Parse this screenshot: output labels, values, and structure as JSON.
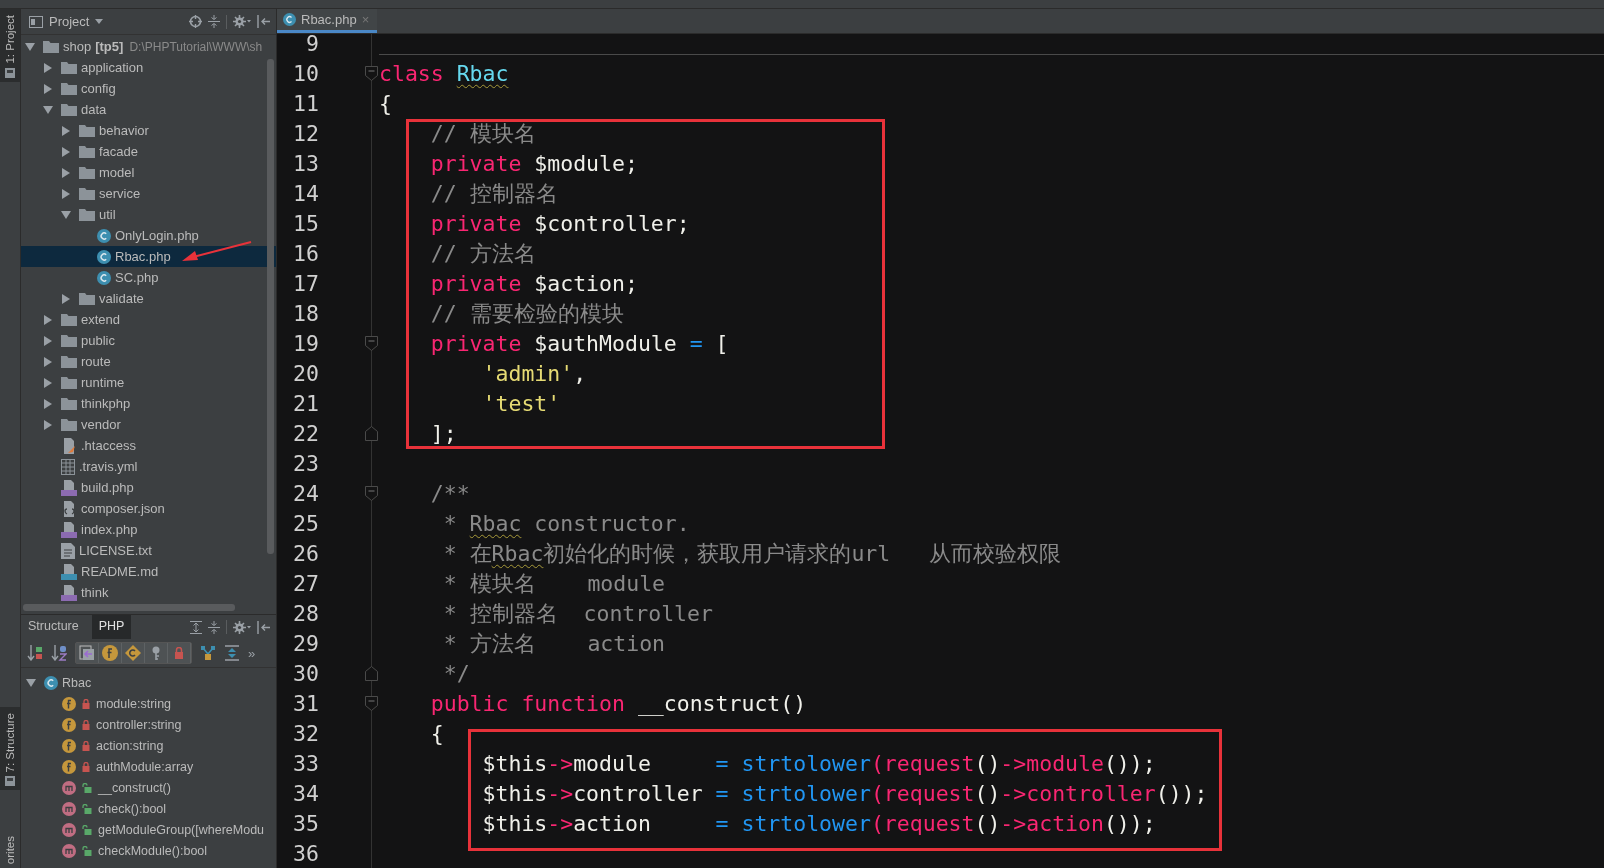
{
  "tool_strip": {
    "items": [
      {
        "label": "1: Project",
        "selected": true
      },
      {
        "label": "7: Structure",
        "selected": true
      },
      {
        "label": "orites",
        "selected": false
      }
    ]
  },
  "project": {
    "title": "Project",
    "tree": [
      {
        "name": "shop",
        "tag": "[tp5]",
        "path": "D:\\PHPTutorial\\WWW\\sh",
        "kind": "folder",
        "expanded": true,
        "selected": false,
        "children": [
          {
            "name": "application",
            "kind": "folder",
            "expanded": false,
            "selected": false
          },
          {
            "name": "config",
            "kind": "folder",
            "expanded": false,
            "selected": false
          },
          {
            "name": "data",
            "kind": "folder",
            "expanded": true,
            "selected": false,
            "children": [
              {
                "name": "behavior",
                "kind": "folder",
                "expanded": false,
                "selected": false
              },
              {
                "name": "facade",
                "kind": "folder",
                "expanded": false,
                "selected": false
              },
              {
                "name": "model",
                "kind": "folder",
                "expanded": false,
                "selected": false
              },
              {
                "name": "service",
                "kind": "folder",
                "expanded": false,
                "selected": false
              },
              {
                "name": "util",
                "kind": "folder",
                "expanded": true,
                "selected": false,
                "children": [
                  {
                    "name": "OnlyLogin.php",
                    "kind": "class",
                    "selected": false
                  },
                  {
                    "name": "Rbac.php",
                    "kind": "class",
                    "selected": true
                  },
                  {
                    "name": "SC.php",
                    "kind": "class",
                    "selected": false
                  }
                ]
              },
              {
                "name": "validate",
                "kind": "folder",
                "expanded": false,
                "selected": false
              }
            ]
          },
          {
            "name": "extend",
            "kind": "folder",
            "expanded": false,
            "selected": false
          },
          {
            "name": "public",
            "kind": "folder",
            "expanded": false,
            "selected": false
          },
          {
            "name": "route",
            "kind": "folder",
            "expanded": false,
            "selected": false
          },
          {
            "name": "runtime",
            "kind": "folder",
            "expanded": false,
            "selected": false
          },
          {
            "name": "thinkphp",
            "kind": "folder",
            "expanded": false,
            "selected": false
          },
          {
            "name": "vendor",
            "kind": "folder",
            "expanded": false,
            "selected": false
          },
          {
            "name": ".htaccess",
            "kind": "htaccess",
            "selected": false
          },
          {
            "name": ".travis.yml",
            "kind": "yml",
            "selected": false
          },
          {
            "name": "build.php",
            "kind": "php",
            "selected": false
          },
          {
            "name": "composer.json",
            "kind": "json",
            "selected": false
          },
          {
            "name": "index.php",
            "kind": "php",
            "selected": false
          },
          {
            "name": "LICENSE.txt",
            "kind": "txt",
            "selected": false
          },
          {
            "name": "README.md",
            "kind": "md",
            "selected": false
          },
          {
            "name": "think",
            "kind": "php",
            "selected": false
          }
        ]
      }
    ]
  },
  "structure": {
    "tabs": [
      {
        "label": "Structure",
        "selected": false
      },
      {
        "label": "PHP",
        "selected": true
      }
    ],
    "more": "»",
    "tree": [
      {
        "name": "Rbac",
        "kind": "class",
        "expanded": true,
        "selected": false,
        "children": [
          {
            "name": "module:string",
            "kind": "field",
            "locked": true,
            "selected": false
          },
          {
            "name": "controller:string",
            "kind": "field",
            "locked": true,
            "selected": false
          },
          {
            "name": "action:string",
            "kind": "field",
            "locked": true,
            "selected": false
          },
          {
            "name": "authModule:array",
            "kind": "field",
            "locked": true,
            "selected": false
          },
          {
            "name": "__construct()",
            "kind": "method",
            "locked": false,
            "selected": false
          },
          {
            "name": "check():bool",
            "kind": "method",
            "locked": false,
            "selected": false
          },
          {
            "name": "getModuleGroup([whereModu",
            "kind": "method",
            "locked": false,
            "selected": false
          },
          {
            "name": "checkModule():bool",
            "kind": "method",
            "locked": false,
            "selected": false
          }
        ]
      }
    ]
  },
  "editor": {
    "tabs": [
      {
        "label": "Rbac.php",
        "close": "×",
        "selected": true
      }
    ],
    "lines": [
      {
        "number": "9"
      },
      {
        "number": "10",
        "fold_start": true,
        "separator_above": true,
        "tokens": [
          {
            "kind": "kw",
            "text": "class "
          },
          {
            "kind": "cls",
            "text": "Rbac",
            "squiggle": true
          }
        ]
      },
      {
        "number": "11",
        "tokens": [
          {
            "kind": "plain",
            "text": "{"
          }
        ]
      },
      {
        "number": "12",
        "tokens": [
          {
            "kind": "comment",
            "text": "    // 模块名"
          }
        ]
      },
      {
        "number": "13",
        "tokens": [
          {
            "kind": "kw",
            "text": "    private"
          },
          {
            "kind": "plain",
            "text": " $module;"
          }
        ]
      },
      {
        "number": "14",
        "tokens": [
          {
            "kind": "comment",
            "text": "    // 控制器名"
          }
        ]
      },
      {
        "number": "15",
        "tokens": [
          {
            "kind": "kw",
            "text": "    private"
          },
          {
            "kind": "plain",
            "text": " $controller;"
          }
        ]
      },
      {
        "number": "16",
        "tokens": [
          {
            "kind": "comment",
            "text": "    // 方法名"
          }
        ]
      },
      {
        "number": "17",
        "tokens": [
          {
            "kind": "kw",
            "text": "    private"
          },
          {
            "kind": "plain",
            "text": " $action;"
          }
        ]
      },
      {
        "number": "18",
        "tokens": [
          {
            "kind": "comment",
            "text": "    // 需要检验的模块"
          }
        ]
      },
      {
        "number": "19",
        "fold_start": true,
        "tokens": [
          {
            "kind": "kw",
            "text": "    private"
          },
          {
            "kind": "plain",
            "text": " $authModule "
          },
          {
            "kind": "op",
            "text": "="
          },
          {
            "kind": "plain",
            "text": " ["
          }
        ]
      },
      {
        "number": "20",
        "tokens": [
          {
            "kind": "str",
            "text": "        'admin'"
          },
          {
            "kind": "plain",
            "text": ","
          }
        ]
      },
      {
        "number": "21",
        "tokens": [
          {
            "kind": "str",
            "text": "        'test'"
          }
        ]
      },
      {
        "number": "22",
        "fold_end": true,
        "tokens": [
          {
            "kind": "plain",
            "text": "    ];"
          }
        ]
      },
      {
        "number": "23"
      },
      {
        "number": "24",
        "fold_start": true,
        "tokens": [
          {
            "kind": "comment",
            "text": "    /**"
          }
        ]
      },
      {
        "number": "25",
        "tokens": [
          {
            "kind": "comment",
            "text": "     * "
          },
          {
            "kind": "comment",
            "text": "Rbac",
            "squiggle": true
          },
          {
            "kind": "comment",
            "text": " constructor."
          }
        ]
      },
      {
        "number": "26",
        "tokens": [
          {
            "kind": "comment",
            "text": "     * 在"
          },
          {
            "kind": "comment",
            "text": "Rbac",
            "squiggle": true
          },
          {
            "kind": "comment",
            "text": "初始化的时候，获取用户请求的url   从而校验权限"
          }
        ]
      },
      {
        "number": "27",
        "tokens": [
          {
            "kind": "comment",
            "text": "     * 模块名    module"
          }
        ]
      },
      {
        "number": "28",
        "tokens": [
          {
            "kind": "comment",
            "text": "     * 控制器名  controller"
          }
        ]
      },
      {
        "number": "29",
        "tokens": [
          {
            "kind": "comment",
            "text": "     * 方法名    action"
          }
        ]
      },
      {
        "number": "30",
        "fold_end": true,
        "tokens": [
          {
            "kind": "comment",
            "text": "     */"
          }
        ]
      },
      {
        "number": "31",
        "fold_start": true,
        "tokens": [
          {
            "kind": "kw",
            "text": "    public function"
          },
          {
            "kind": "plain",
            "text": " __construct()"
          }
        ]
      },
      {
        "number": "32",
        "tokens": [
          {
            "kind": "plain",
            "text": "    {"
          }
        ]
      },
      {
        "number": "33",
        "tokens": [
          {
            "kind": "plain",
            "text": "        $this"
          },
          {
            "kind": "kw",
            "text": "->"
          },
          {
            "kind": "plain",
            "text": "module     "
          },
          {
            "kind": "op",
            "text": "= strtolower"
          },
          {
            "kind": "kw",
            "text": "(request"
          },
          {
            "kind": "plain",
            "text": "()"
          },
          {
            "kind": "kw",
            "text": "->module"
          },
          {
            "kind": "plain",
            "text": "());"
          }
        ]
      },
      {
        "number": "34",
        "tokens": [
          {
            "kind": "plain",
            "text": "        $this"
          },
          {
            "kind": "kw",
            "text": "->"
          },
          {
            "kind": "plain",
            "text": "controller "
          },
          {
            "kind": "op",
            "text": "= strtolower"
          },
          {
            "kind": "kw",
            "text": "(request"
          },
          {
            "kind": "plain",
            "text": "()"
          },
          {
            "kind": "kw",
            "text": "->controller"
          },
          {
            "kind": "plain",
            "text": "());"
          }
        ]
      },
      {
        "number": "35",
        "tokens": [
          {
            "kind": "plain",
            "text": "        $this"
          },
          {
            "kind": "kw",
            "text": "->"
          },
          {
            "kind": "plain",
            "text": "action     "
          },
          {
            "kind": "op",
            "text": "= strtolower"
          },
          {
            "kind": "kw",
            "text": "(request"
          },
          {
            "kind": "plain",
            "text": "()"
          },
          {
            "kind": "kw",
            "text": "->action"
          },
          {
            "kind": "plain",
            "text": "());"
          }
        ]
      },
      {
        "number": "36"
      }
    ]
  }
}
